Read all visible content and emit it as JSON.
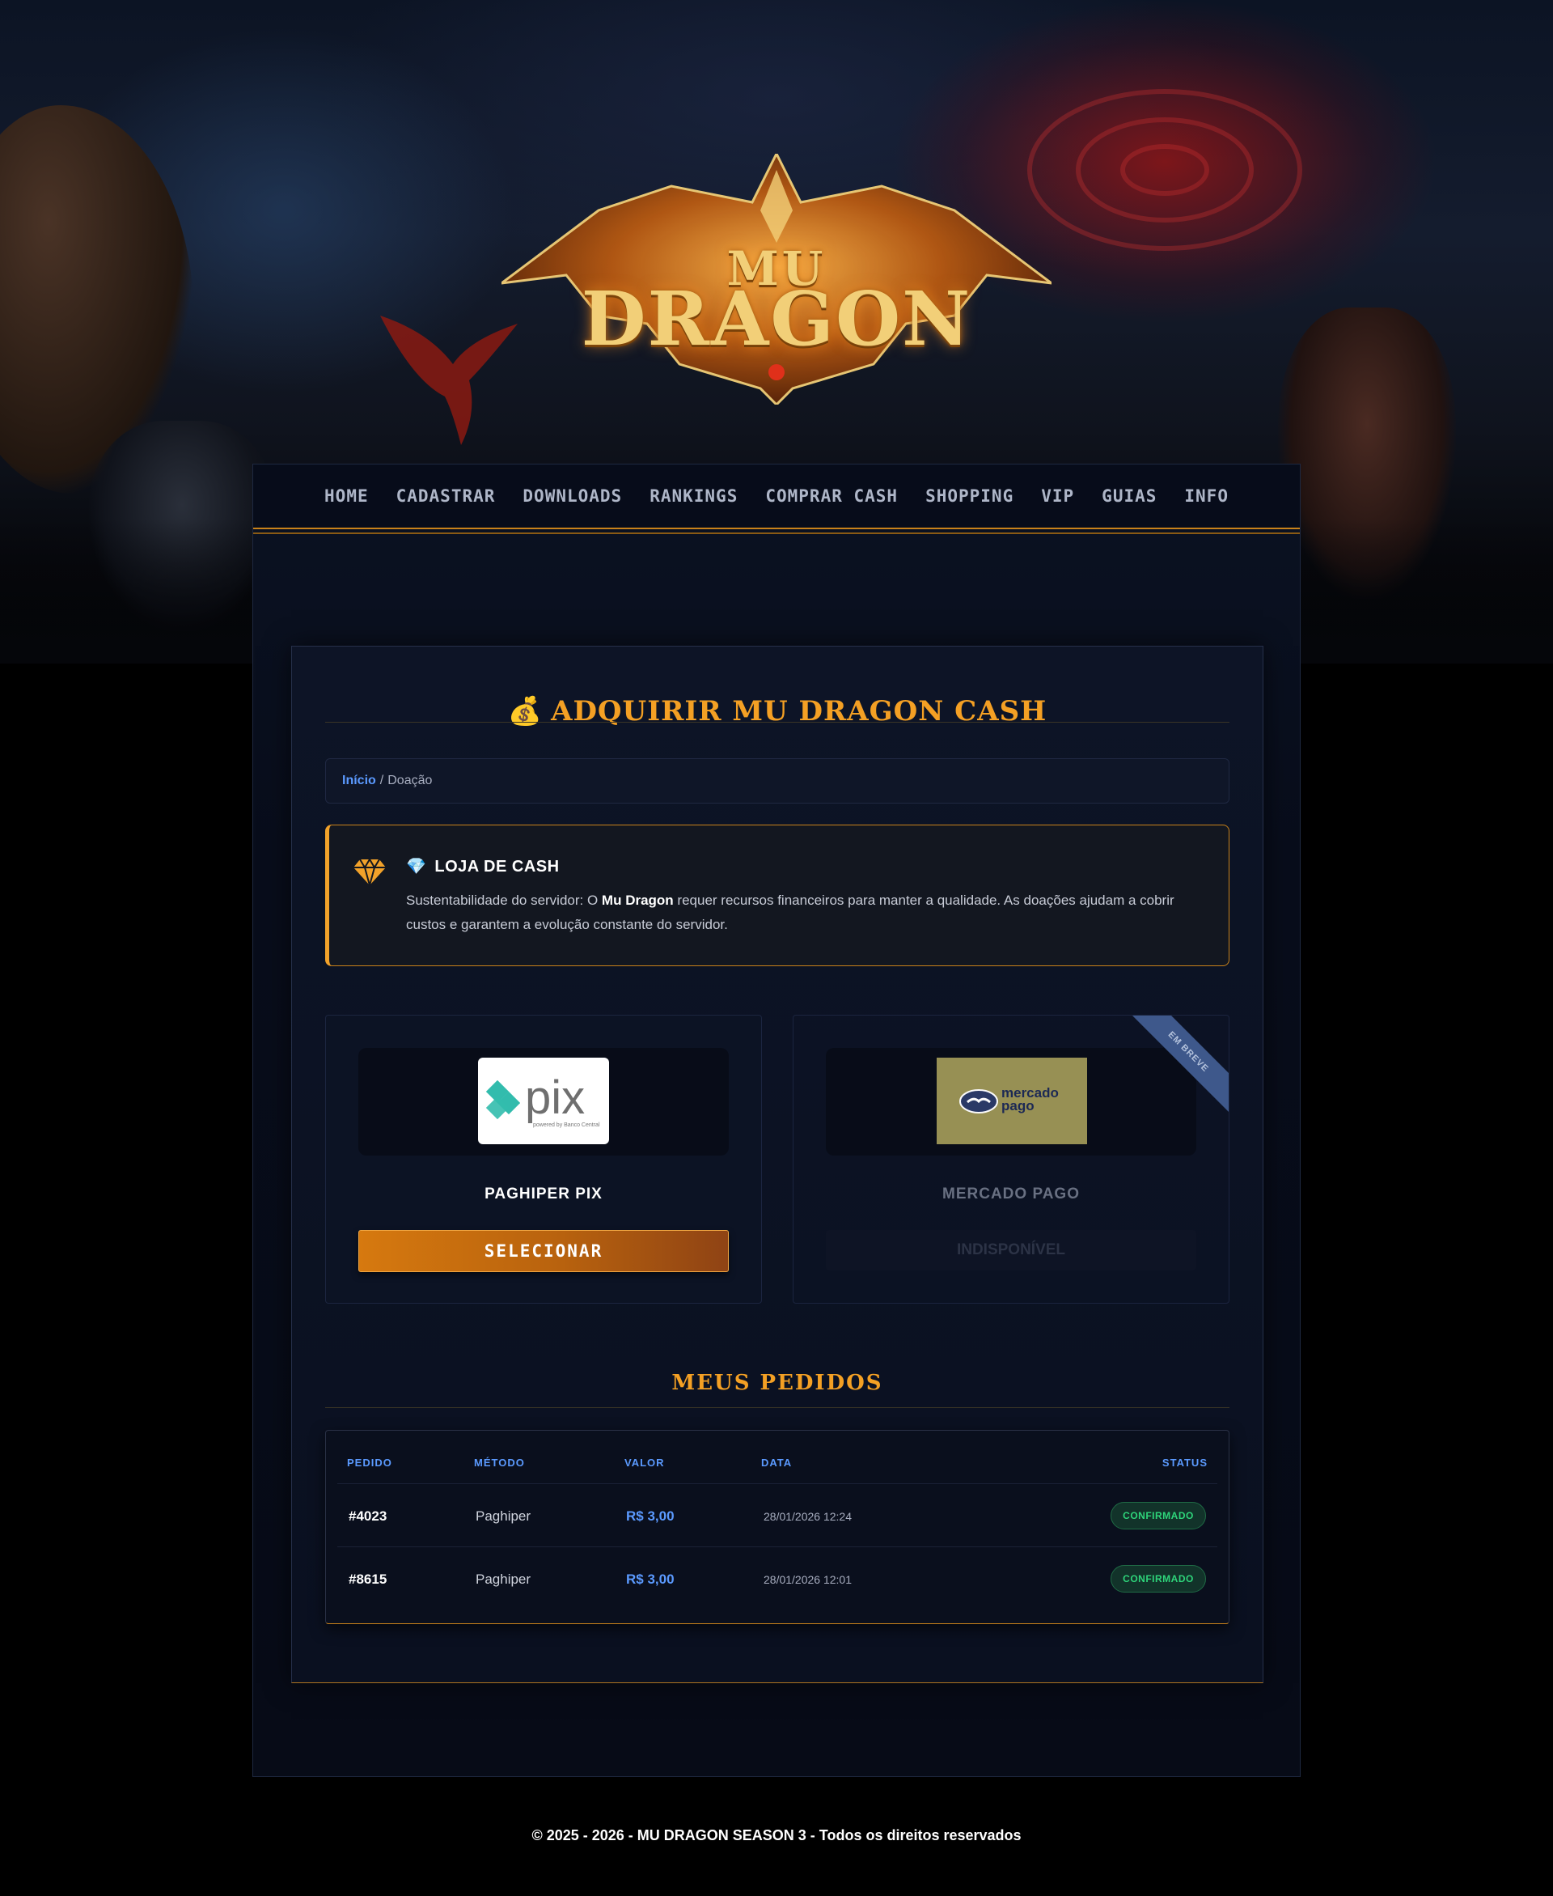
{
  "logo": {
    "line1": "MU",
    "line2": "DRAGON"
  },
  "nav": {
    "items": [
      "HOME",
      "CADASTRAR",
      "DOWNLOADS",
      "RANKINGS",
      "COMPRAR CASH",
      "SHOPPING",
      "VIP",
      "GUIAS",
      "INFO"
    ]
  },
  "page": {
    "title_icon": "💰",
    "title": "ADQUIRIR MU DRAGON CASH",
    "breadcrumb": {
      "home": "Início",
      "separator": "/",
      "current": "Doação"
    }
  },
  "alert": {
    "icon": "gem-icon",
    "title_icon": "💎",
    "title": "LOJA DE CASH",
    "text_before": "Sustentabilidade do servidor: O ",
    "text_bold": "Mu Dragon",
    "text_after": " requer recursos financeiros para manter a qualidade. As doações ajudam a cobrir custos e garantem a evolução constante do servidor."
  },
  "payments": [
    {
      "name": "PAGHIPER PIX",
      "button": "SELECIONAR",
      "logo_text": "pix",
      "logo_sub": "powered by Banco Central"
    },
    {
      "name": "MERCADO PAGO",
      "button": "INDISPONÍVEL",
      "logo_line1": "mercado",
      "logo_line2": "pago",
      "ribbon": "EM BREVE",
      "ribbon_color": "#3f5a8e",
      "logo_bg": "#9a9355"
    }
  ],
  "orders": {
    "title": "MEUS PEDIDOS",
    "headers": {
      "pedido": "PEDIDO",
      "metodo": "MÉTODO",
      "valor": "VALOR",
      "data": "DATA",
      "status": "STATUS"
    },
    "rows": [
      {
        "pedido": "#4023",
        "metodo": "Paghiper",
        "valor": "R$ 3,00",
        "data": "28/01/2026 12:24",
        "status": "CONFIRMADO"
      },
      {
        "pedido": "#8615",
        "metodo": "Paghiper",
        "valor": "R$ 3,00",
        "data": "28/01/2026 12:01",
        "status": "CONFIRMADO"
      }
    ]
  },
  "footer": {
    "text": "© 2025 - 2026 - MU DRAGON SEASON 3 - Todos os direitos reservados"
  },
  "colors": {
    "accent": "#f4a024",
    "link": "#5b9aff",
    "success": "#2ed47a"
  }
}
